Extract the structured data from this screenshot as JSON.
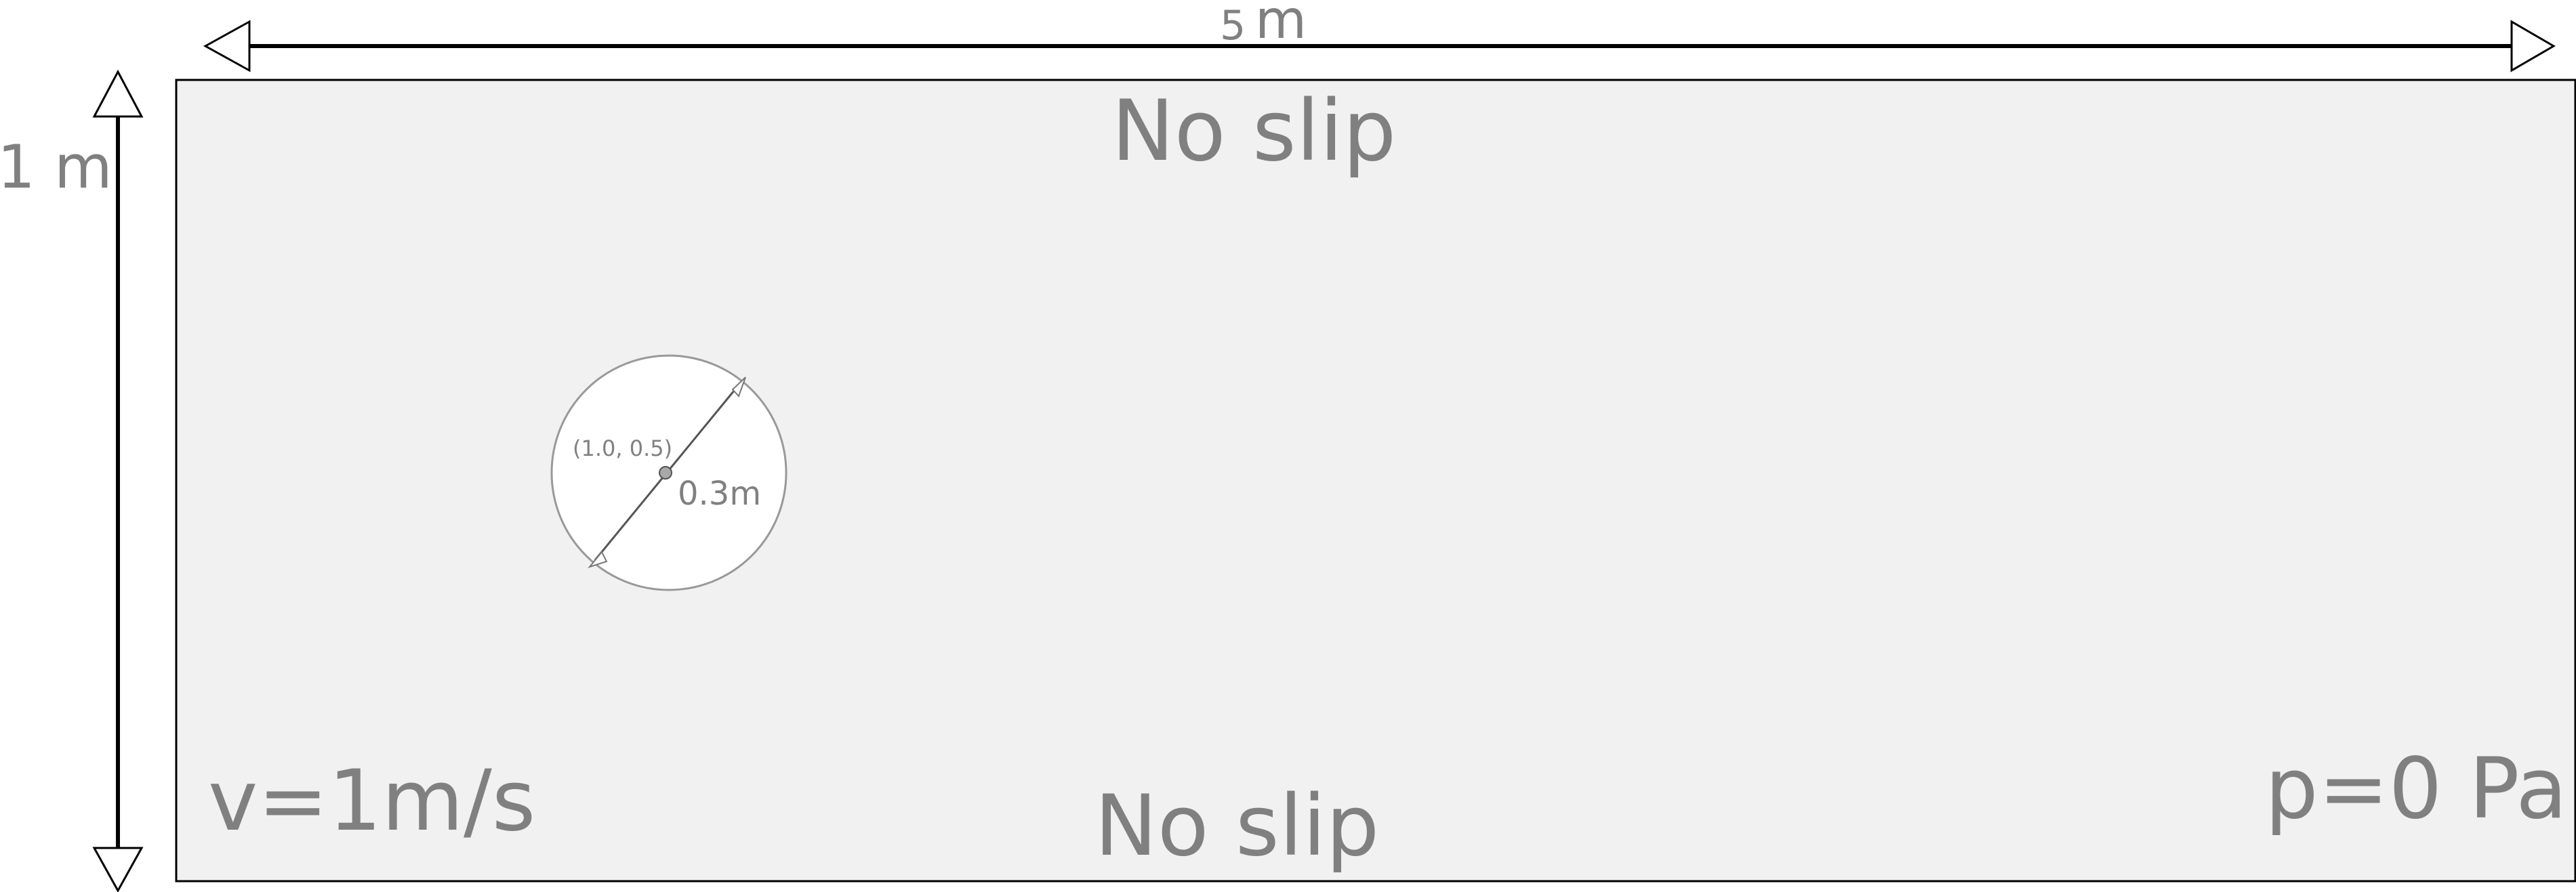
{
  "width_dim": {
    "number": "5",
    "unit": "m"
  },
  "height_dim": {
    "label": "1 m"
  },
  "walls": {
    "top_label": "No slip",
    "bottom_label": "No slip"
  },
  "inlet": {
    "label": "v=1m/s"
  },
  "outlet": {
    "label": "p=0 Pa"
  },
  "cylinder": {
    "center_label": "(1.0, 0.5)",
    "diameter_label": "0.3m"
  },
  "colors": {
    "domain_fill": "#f1f1f1",
    "label_gray": "#808080",
    "outline": "#000000",
    "cylinder_fill": "#ffffff"
  }
}
